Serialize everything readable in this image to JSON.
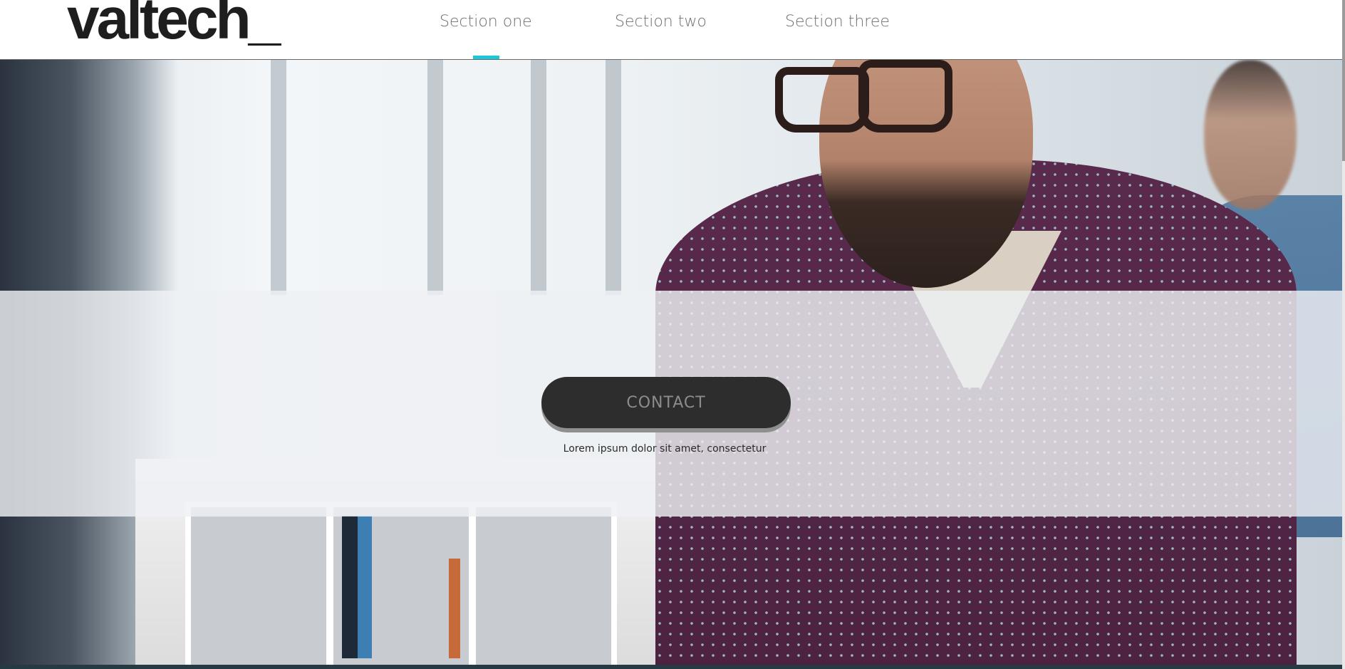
{
  "brand": {
    "logo_text": "valtech",
    "logo_suffix": "_"
  },
  "nav": {
    "items": [
      {
        "label": "Section one",
        "active": true
      },
      {
        "label": "Section two",
        "active": false
      },
      {
        "label": "Section three",
        "active": false
      }
    ],
    "accent_color": "#1fc6d8"
  },
  "hero": {
    "cta_label": "CONTACT",
    "tagline": "Lorem ipsum dolor sit amet, consectetur"
  }
}
